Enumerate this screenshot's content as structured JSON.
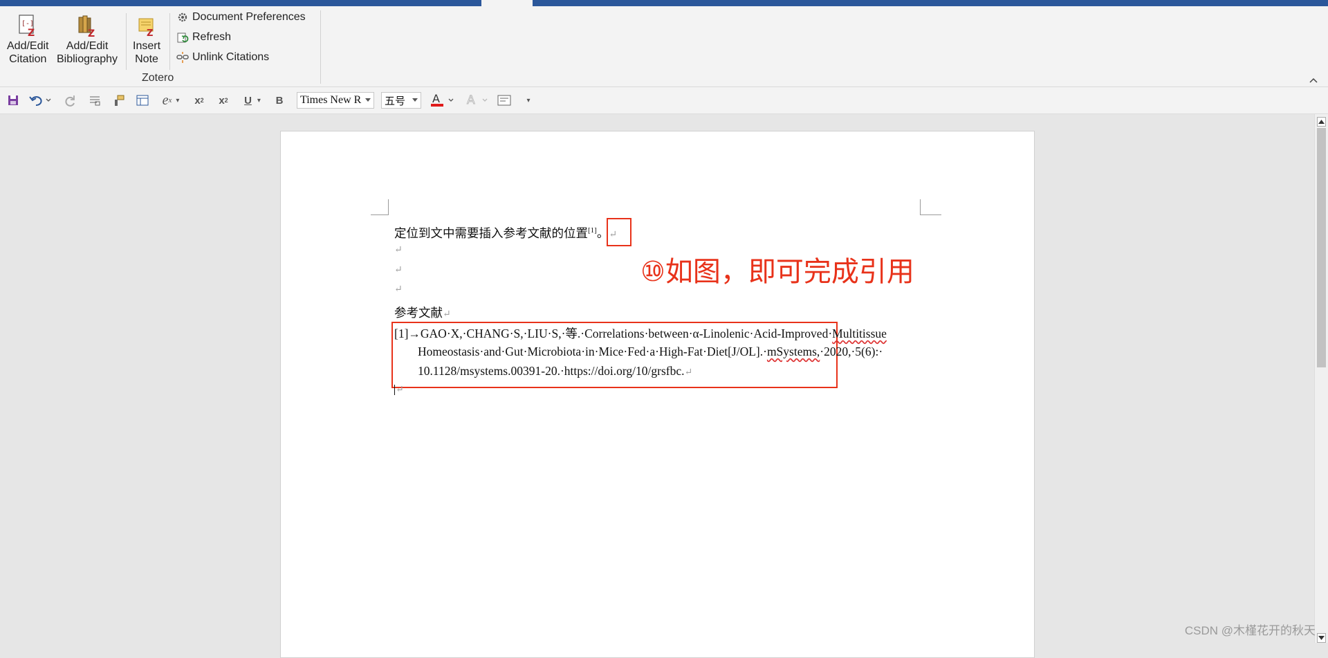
{
  "ribbon": {
    "add_edit_citation": "Add/Edit\nCitation",
    "add_edit_citation_l1": "Add/Edit",
    "add_edit_citation_l2": "Citation",
    "add_edit_bibliography_l1": "Add/Edit",
    "add_edit_bibliography_l2": "Bibliography",
    "insert_note_l1": "Insert",
    "insert_note_l2": "Note",
    "document_preferences": "Document Preferences",
    "refresh": "Refresh",
    "unlink_citations": "Unlink Citations",
    "group_name": "Zotero"
  },
  "quick_access": {
    "font_name": "Times New R",
    "font_size": "五号",
    "bold_label": "B",
    "underline_label": "U"
  },
  "document": {
    "line1_text": "定位到文中需要插入参考文献的位置",
    "citation_mark": "[1]",
    "line1_tail": "。",
    "heading": "参考文献",
    "ref_l1_prefix": "[1]→GAO·X,·CHANG·S,·LIU·S,·等.·Correlations·between·α-Linolenic·Acid-Improved·",
    "ref_l1_squig": "Multitissue",
    "ref_l2_a": "Homeostasis·and·Gut·Microbiota·in·Mice·Fed·a·High-Fat·Diet[J/OL].·",
    "ref_l2_squig": "mSystems,",
    "ref_l2_b": "·2020,·5(6):·",
    "ref_l3": "10.1128/msystems.00391-20.·https://doi.org/10/grsfbc.",
    "paragraph_mark": "↵"
  },
  "annotation": "⑩如图，即可完成引用",
  "watermark": "CSDN @木槿花开的秋天",
  "colors": {
    "accent_blue": "#2b579a",
    "annotation_red": "#e8321a"
  }
}
